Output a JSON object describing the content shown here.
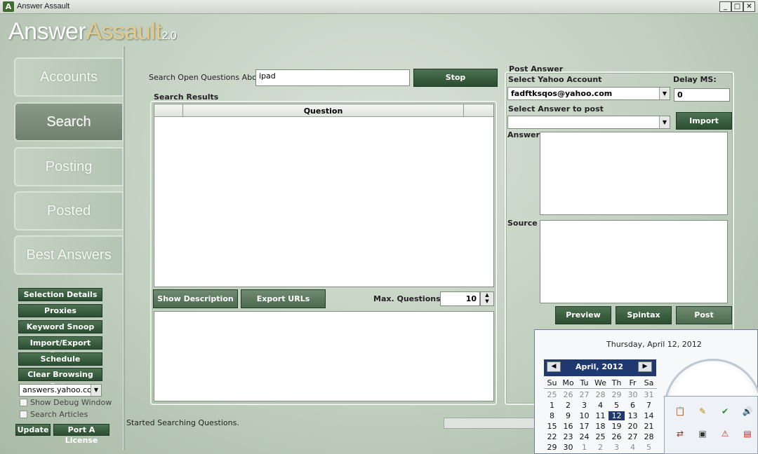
{
  "window": {
    "title": "Answer Assault",
    "min": "_",
    "max": "□",
    "close": "✕"
  },
  "logo": {
    "part1": "Answer",
    "part2": "Assault",
    "version": "2.0"
  },
  "nav": [
    "Accounts",
    "Search",
    "Posting",
    "Posted",
    "Best Answers"
  ],
  "side_buttons": [
    "Selection Details",
    "Proxies",
    "Keyword Snoop",
    "Import/Export Data",
    "Schedule",
    "Clear Browsing Data"
  ],
  "site_select": "answers.yahoo.com",
  "checkboxes": {
    "debug": "Show Debug Window",
    "articles": "Search Articles"
  },
  "bottom_buttons": {
    "update": "Update",
    "port": "Port A License"
  },
  "search": {
    "label": "Search Open Questions About:",
    "value": "ipad",
    "stop": "Stop"
  },
  "results": {
    "legend": "Search Results",
    "column_question": "Question"
  },
  "actions": {
    "show_description": "Show Description",
    "export_urls": "Export URLs",
    "max_label": "Max. Questions:",
    "max_value": "10"
  },
  "status": "Started Searching Questions.",
  "post": {
    "legend": "Post Answer",
    "account_label": "Select Yahoo Account",
    "account_value": "fadftksqos@yahoo.com",
    "delay_label": "Delay MS:",
    "delay_value": "0",
    "answer_select_label": "Select Answer to post",
    "import": "Import",
    "answer_label": "Answer",
    "source_label": "Source",
    "preview": "Preview",
    "spintax": "Spintax",
    "post": "Post"
  },
  "calendar": {
    "date_text": "Thursday, April 12, 2012",
    "month": "April, 2012",
    "prev": "◀",
    "next": "▶",
    "weekdays": [
      "Su",
      "Mo",
      "Tu",
      "We",
      "Th",
      "Fr",
      "Sa"
    ],
    "weeks": [
      [
        "25",
        "26",
        "27",
        "28",
        "29",
        "30",
        "31"
      ],
      [
        "1",
        "2",
        "3",
        "4",
        "5",
        "6",
        "7"
      ],
      [
        "8",
        "9",
        "10",
        "11",
        "12",
        "13",
        "14"
      ],
      [
        "15",
        "16",
        "17",
        "18",
        "19",
        "20",
        "21"
      ],
      [
        "22",
        "23",
        "24",
        "25",
        "26",
        "27",
        "28"
      ],
      [
        "29",
        "30",
        "1",
        "2",
        "3",
        "4",
        "5"
      ]
    ],
    "selected": "12"
  },
  "tray_icons": [
    "clipboard-icon",
    "chat-icon",
    "check-icon",
    "speaker-icon",
    "network-icon",
    "monitor-icon",
    "warning-icon",
    "pdf-icon"
  ],
  "colors": {
    "accent_green": "#2b4d31",
    "calendar_header": "#1f3870"
  }
}
